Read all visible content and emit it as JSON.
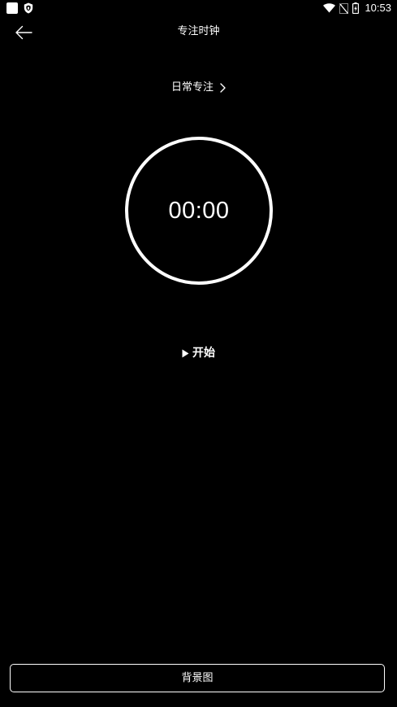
{
  "status_bar": {
    "time": "10:53",
    "icons": [
      "notification-square-icon",
      "shield-icon",
      "wifi-icon",
      "no-sim-icon",
      "battery-charging-icon"
    ]
  },
  "header": {
    "title": "专注时钟",
    "back_icon": "arrow-left-icon"
  },
  "category": {
    "label": "日常专注",
    "icon": "chevron-right-icon"
  },
  "timer": {
    "value": "00:00"
  },
  "start_button": {
    "label": "开始",
    "icon": "play-icon"
  },
  "background_button": {
    "label": "背景图"
  },
  "colors": {
    "background": "#000000",
    "foreground": "#ffffff"
  }
}
